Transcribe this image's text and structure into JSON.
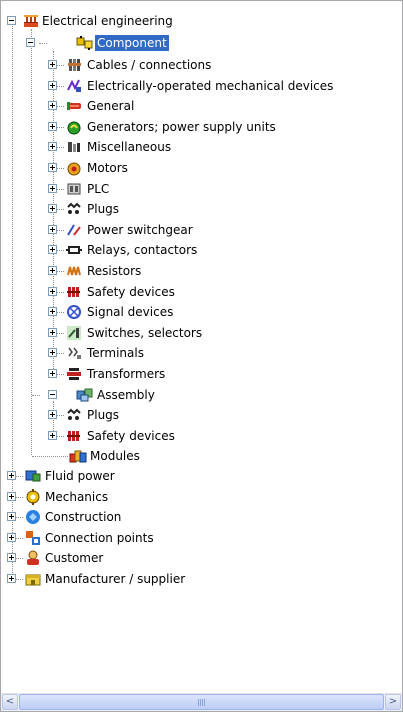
{
  "tree": {
    "root": {
      "label": "Electrical engineering",
      "component": {
        "label": "Component",
        "items": [
          {
            "label": "Cables / connections",
            "icon": "cable-icon"
          },
          {
            "label": "Electrically-operated mechanical devices",
            "icon": "mechanical-device-icon"
          },
          {
            "label": "General",
            "icon": "general-icon"
          },
          {
            "label": "Generators; power supply units",
            "icon": "generator-icon"
          },
          {
            "label": "Miscellaneous",
            "icon": "miscellaneous-icon"
          },
          {
            "label": "Motors",
            "icon": "motor-icon"
          },
          {
            "label": "PLC",
            "icon": "plc-icon"
          },
          {
            "label": "Plugs",
            "icon": "plug-icon"
          },
          {
            "label": "Power switchgear",
            "icon": "switchgear-icon"
          },
          {
            "label": "Relays, contactors",
            "icon": "relay-icon"
          },
          {
            "label": "Resistors",
            "icon": "resistor-icon"
          },
          {
            "label": "Safety devices",
            "icon": "safety-device-icon"
          },
          {
            "label": "Signal devices",
            "icon": "signal-device-icon"
          },
          {
            "label": "Switches, selectors",
            "icon": "switch-icon"
          },
          {
            "label": "Terminals",
            "icon": "terminal-icon"
          },
          {
            "label": "Transformers",
            "icon": "transformer-icon"
          }
        ]
      },
      "assembly": {
        "label": "Assembly",
        "items": [
          {
            "label": "Plugs",
            "icon": "plug-icon"
          },
          {
            "label": "Safety devices",
            "icon": "safety-device-icon"
          }
        ]
      },
      "modules": {
        "label": "Modules",
        "icon": "modules-icon"
      }
    },
    "top_level": [
      {
        "label": "Fluid power",
        "icon": "fluid-power-icon"
      },
      {
        "label": "Mechanics",
        "icon": "mechanics-icon"
      },
      {
        "label": "Construction",
        "icon": "construction-icon"
      },
      {
        "label": "Connection points",
        "icon": "connection-points-icon"
      },
      {
        "label": "Customer",
        "icon": "customer-icon"
      },
      {
        "label": "Manufacturer / supplier",
        "icon": "manufacturer-icon"
      }
    ]
  },
  "scrollbar": {
    "left_arrow": "<",
    "right_arrow": ">"
  },
  "colors": {
    "selection": "#316ac5",
    "connector": "#8e8e8e",
    "toggle_border": "#7f9db9"
  }
}
